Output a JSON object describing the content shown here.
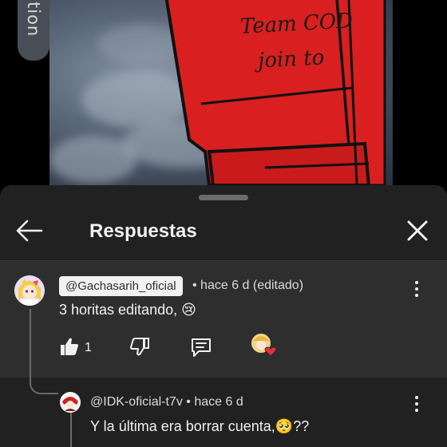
{
  "video": {
    "side_text": "tion",
    "drawing_text_line1": "Team COD",
    "drawing_text_line2": "join to"
  },
  "sheet": {
    "title": "Respuestas"
  },
  "comment": {
    "author": "@Gachasarih_oficial",
    "meta": "• hace 6 d (editado)",
    "text": "3 horitas editando, 😢",
    "likes": "1"
  },
  "reply": {
    "author": "@IDK-oficial-t7v",
    "meta": "• hace 6 d",
    "text": "Y la última era borrar cuenta,🥺??"
  },
  "colors": {
    "sheet_bg": "#212121",
    "highlight_bg": "#2e2e2e",
    "creator_heart": "#e62e3d",
    "text": "#f1f1f1"
  },
  "icons": [
    "back-arrow-icon",
    "close-icon",
    "thumbs-up-icon",
    "thumbs-down-icon",
    "reply-icon",
    "more-vert-icon",
    "creator-heart-icon"
  ]
}
